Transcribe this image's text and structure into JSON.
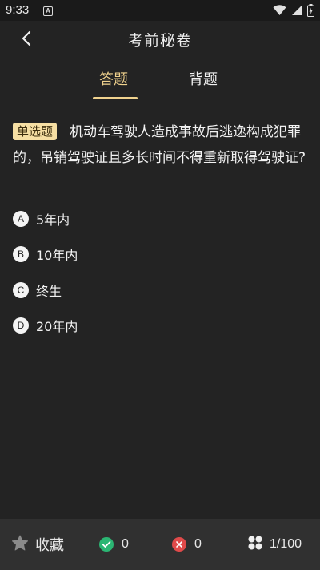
{
  "status_bar": {
    "time": "9:33",
    "notification_icon": "A"
  },
  "header": {
    "title": "考前秘卷",
    "back_icon": "chevron-left-icon"
  },
  "tabs": [
    {
      "label": "答题",
      "active": true
    },
    {
      "label": "背题",
      "active": false
    }
  ],
  "question": {
    "type": "单选题",
    "text": "机动车驾驶人造成事故后逃逸构成犯罪的，吊销驾驶证且多长时间不得重新取得驾驶证?",
    "options": [
      {
        "letter": "A",
        "text": "5年内"
      },
      {
        "letter": "B",
        "text": "10年内"
      },
      {
        "letter": "C",
        "text": "终生"
      },
      {
        "letter": "D",
        "text": "20年内"
      }
    ]
  },
  "bottom_bar": {
    "favorite_label": "收藏",
    "correct_count": "0",
    "wrong_count": "0",
    "progress": "1/100"
  },
  "colors": {
    "background": "#232323",
    "accent": "#f0d28e",
    "badge": "#f6dfa3",
    "correct": "#2bb673",
    "wrong": "#e04a4a",
    "bottom_bar": "#303030"
  }
}
